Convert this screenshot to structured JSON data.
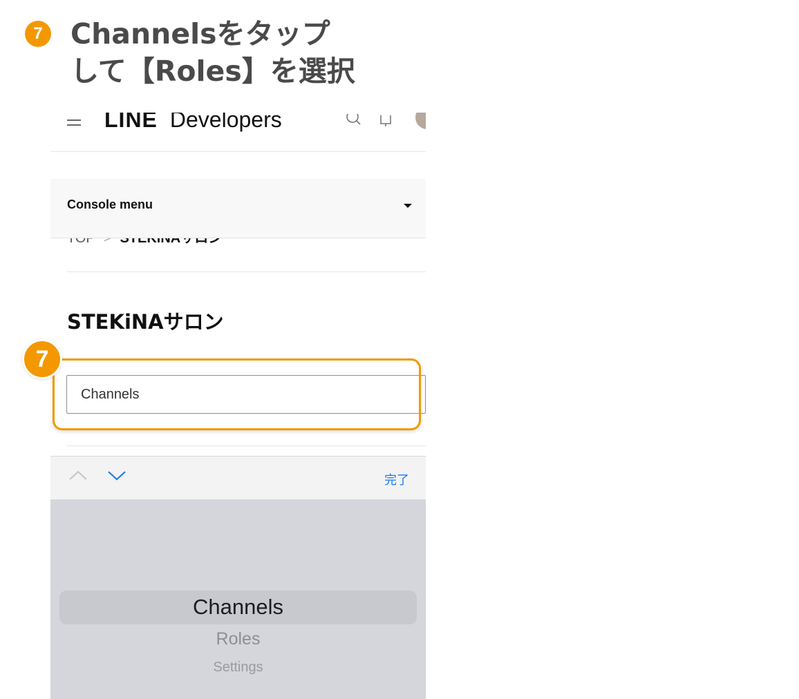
{
  "step": {
    "number": "7",
    "title_line1": "Channelsをタップ",
    "title_line2": "して【Roles】を選択"
  },
  "header": {
    "brand_bold": "LINE",
    "brand_rest": "Developers"
  },
  "console_menu": {
    "label": "Console menu"
  },
  "breadcrumb": {
    "top": "TOP",
    "separator": ">",
    "current": "STEKiNAサロン"
  },
  "page": {
    "title": "STEKiNAサロン"
  },
  "select": {
    "value": "Channels"
  },
  "callout": {
    "number": "7"
  },
  "keyboard_bar": {
    "done_label": "完了"
  },
  "picker": {
    "options": [
      "Channels",
      "Roles",
      "Settings"
    ],
    "selected": "Channels"
  },
  "colors": {
    "accent_orange": "#f39800",
    "ios_blue": "#1a7cf5",
    "picker_bg": "#d4d6db"
  }
}
